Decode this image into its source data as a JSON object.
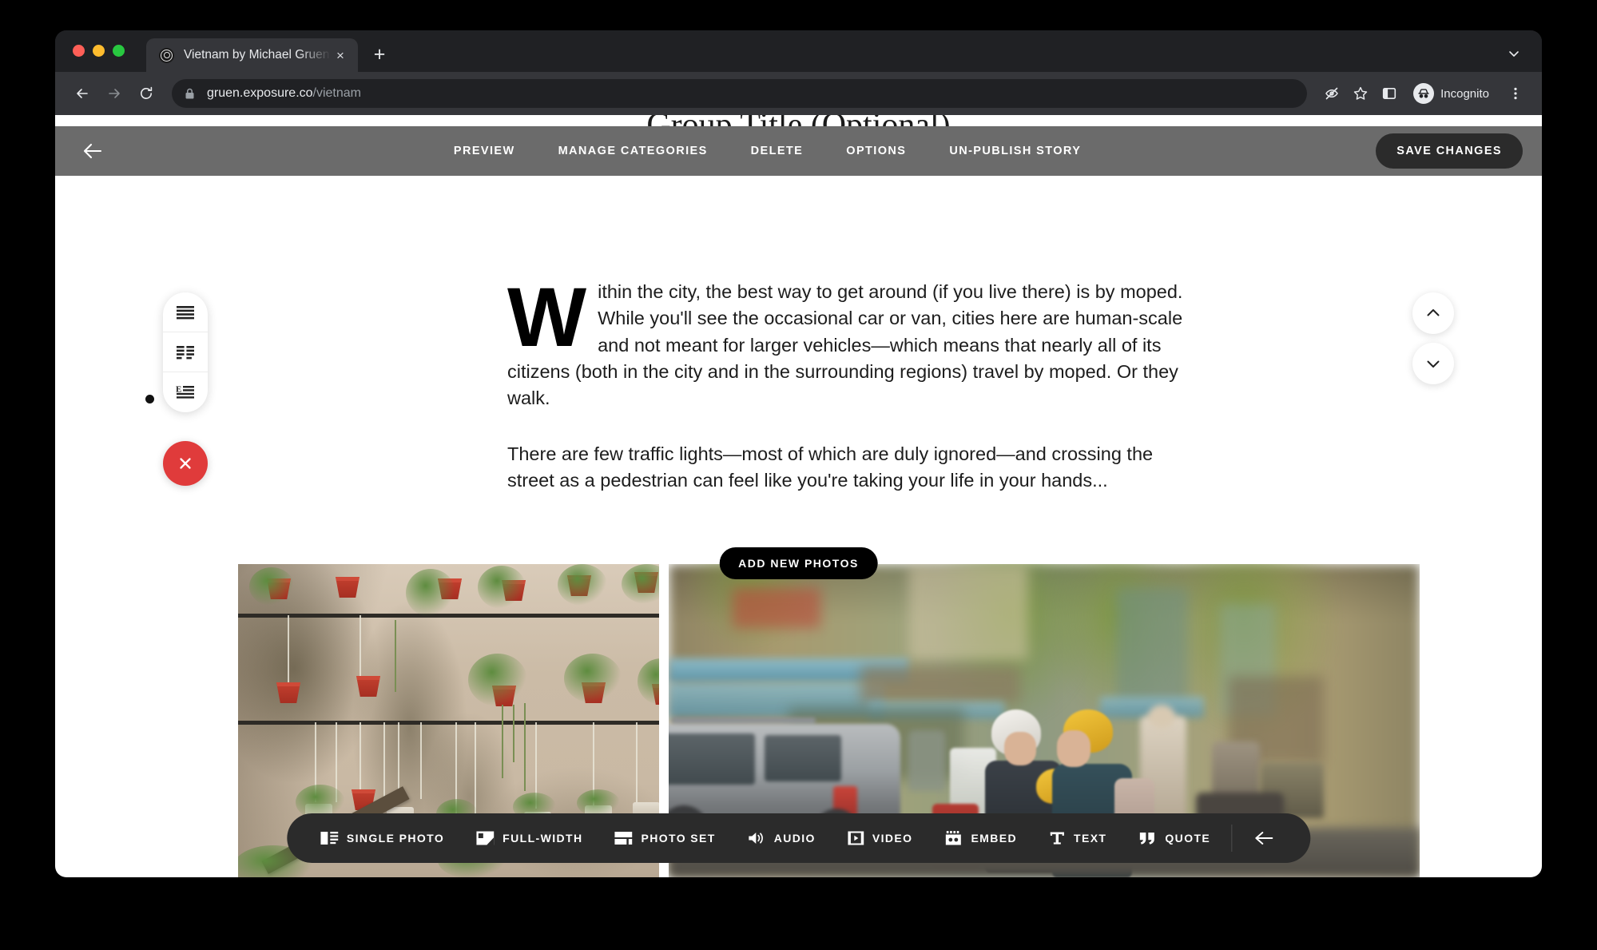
{
  "browser": {
    "tab": {
      "title": "Vietnam by Michael Gruen - Ex",
      "favicon_name": "exposure-logo-icon",
      "close_label": "×"
    },
    "new_tab_label": "+",
    "url": {
      "domain": "gruen.exposure.co",
      "path": "/vietnam"
    },
    "profile": {
      "label": "Incognito"
    },
    "icons": {
      "back": "back-arrow-icon",
      "forward": "forward-arrow-icon",
      "reload": "reload-icon",
      "lock": "lock-icon",
      "tracking": "eye-slash-icon",
      "bookmark": "star-icon",
      "side_panel": "side-panel-icon",
      "menu": "kebab-menu-icon",
      "tab_list": "chevron-down-icon"
    }
  },
  "editor": {
    "story_title": "Group Title (Optional)",
    "back_label": "back-arrow-icon",
    "menu": [
      {
        "label": "PREVIEW",
        "name": "preview"
      },
      {
        "label": "MANAGE CATEGORIES",
        "name": "manage-categories"
      },
      {
        "label": "DELETE",
        "name": "delete"
      },
      {
        "label": "OPTIONS",
        "name": "options"
      },
      {
        "label": "UN-PUBLISH STORY",
        "name": "un-publish-story"
      }
    ],
    "save_label": "SAVE CHANGES"
  },
  "block_picker": {
    "options": [
      {
        "name": "text-full-width-icon",
        "title": "Full width text"
      },
      {
        "name": "text-two-column-icon",
        "title": "Two column text"
      },
      {
        "name": "text-drop-cap-icon",
        "title": "Drop cap text"
      }
    ],
    "selected_index": 2,
    "close_label": "×"
  },
  "move_controls": [
    {
      "name": "move-up-button",
      "icon": "chevron-up-icon"
    },
    {
      "name": "move-down-button",
      "icon": "chevron-down-icon"
    }
  ],
  "article": {
    "paragraphs": [
      "Within the city, the best way to get around (if you live there) is by moped. While you'll see the occasional car or van, cities here are human-scale and not meant for larger vehicles—which means that nearly all of its citizens (both in the city and in the surrounding regions) travel by moped. Or they walk.",
      "There are few traffic lights—most of which are duly ignored—and crossing the street as a pedestrian can feel like you're taking your life in your hands..."
    ]
  },
  "photos": {
    "add_button_label": "ADD NEW PHOTOS",
    "items": [
      {
        "name": "photo-potted-plants-wall",
        "alt": "Weathered wall with hanging red and white flower pots"
      },
      {
        "name": "photo-motorbike-street",
        "alt": "Motion-blurred street scene with motorbike riders in white and yellow helmets"
      }
    ]
  },
  "insert_toolbar": {
    "items": [
      {
        "label": "SINGLE PHOTO",
        "icon": "single-photo-icon",
        "name": "single-photo"
      },
      {
        "label": "FULL-WIDTH",
        "icon": "full-width-icon",
        "name": "full-width"
      },
      {
        "label": "PHOTO SET",
        "icon": "photo-set-icon",
        "name": "photo-set"
      },
      {
        "label": "AUDIO",
        "icon": "audio-icon",
        "name": "audio"
      },
      {
        "label": "VIDEO",
        "icon": "video-icon",
        "name": "video"
      },
      {
        "label": "EMBED",
        "icon": "embed-icon",
        "name": "embed"
      },
      {
        "label": "TEXT",
        "icon": "text-icon",
        "name": "text"
      },
      {
        "label": "QUOTE",
        "icon": "quote-icon",
        "name": "quote"
      }
    ],
    "back_icon": "back-arrow-icon"
  },
  "colors": {
    "editor_bar": "#6b6b6b",
    "accent_red": "#e03b3b",
    "dark_ui": "#2b2b2b",
    "browser_chrome": "#202124"
  }
}
